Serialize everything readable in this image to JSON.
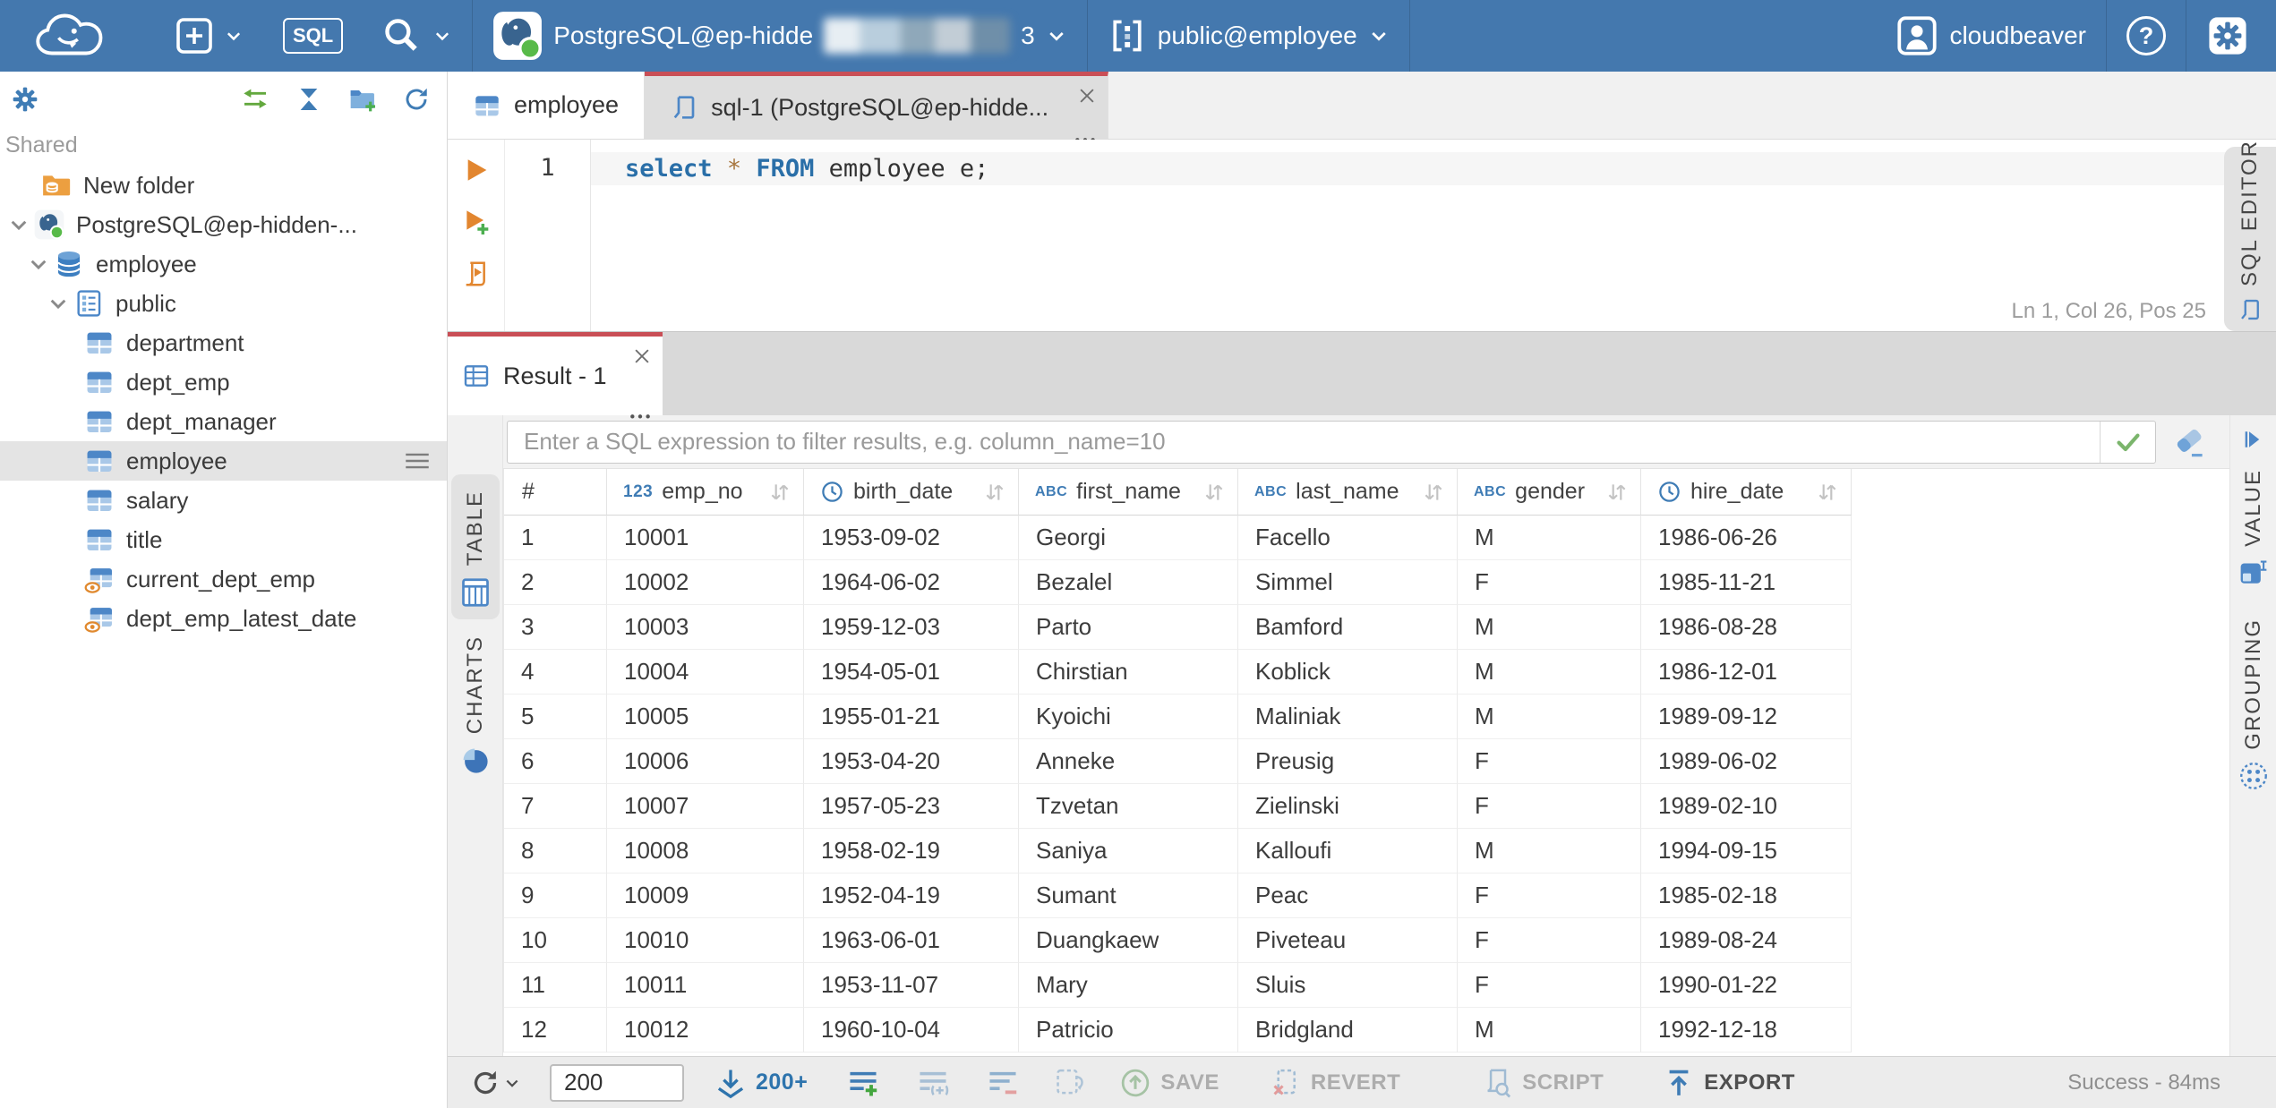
{
  "topbar": {
    "sql_badge": "SQL",
    "connection": {
      "name": "PostgreSQL@ep-hidde",
      "masked_suffix": "3"
    },
    "schema": "public@employee",
    "user": "cloudbeaver",
    "help_glyph": "?"
  },
  "sidebar": {
    "section_label": "Shared",
    "tree": [
      {
        "label": "New folder",
        "icon": "folderdb",
        "pad": 44,
        "chevron": false
      },
      {
        "label": "PostgreSQL@ep-hidden-...",
        "icon": "pg",
        "pad": 6,
        "chevron": true
      },
      {
        "label": "employee",
        "icon": "db",
        "pad": 28,
        "chevron": true
      },
      {
        "label": "public",
        "icon": "schema",
        "pad": 50,
        "chevron": true
      },
      {
        "label": "department",
        "icon": "table",
        "pad": 92,
        "chevron": false
      },
      {
        "label": "dept_emp",
        "icon": "table",
        "pad": 92,
        "chevron": false
      },
      {
        "label": "dept_manager",
        "icon": "table",
        "pad": 92,
        "chevron": false
      },
      {
        "label": "employee",
        "icon": "table",
        "pad": 92,
        "chevron": false,
        "selected": true,
        "menu": true
      },
      {
        "label": "salary",
        "icon": "table",
        "pad": 92,
        "chevron": false
      },
      {
        "label": "title",
        "icon": "table",
        "pad": 92,
        "chevron": false
      },
      {
        "label": "current_dept_emp",
        "icon": "view",
        "pad": 92,
        "chevron": false
      },
      {
        "label": "dept_emp_latest_date",
        "icon": "view",
        "pad": 92,
        "chevron": false
      }
    ]
  },
  "editor": {
    "tabs": [
      {
        "label": "employee"
      },
      {
        "label": "sql-1 (PostgreSQL@ep-hidde..."
      }
    ],
    "line_number": "1",
    "code": [
      {
        "t": "select",
        "c": "kw"
      },
      {
        "t": " ",
        "c": "pl"
      },
      {
        "t": "*",
        "c": "op"
      },
      {
        "t": " ",
        "c": "pl"
      },
      {
        "t": "FROM",
        "c": "kw"
      },
      {
        "t": " employee e;",
        "c": "pl"
      }
    ],
    "status": "Ln 1, Col 26, Pos 25",
    "right_tab_label": "SQL EDITOR"
  },
  "results": {
    "tab_label": "Result - 1",
    "filter_placeholder": "Enter a SQL expression to filter results, e.g. column_name=10",
    "left_tabs": [
      {
        "label": "TABLE"
      },
      {
        "label": "CHARTS"
      }
    ],
    "right_tabs": [
      {
        "label": "VALUE"
      },
      {
        "label": "GROUPING"
      }
    ]
  },
  "result_table": {
    "type_icons": {
      "number": "123",
      "string": "ABC"
    },
    "columns": [
      {
        "name": "#",
        "type": "rownum"
      },
      {
        "name": "emp_no",
        "type": "number"
      },
      {
        "name": "birth_date",
        "type": "date"
      },
      {
        "name": "first_name",
        "type": "string"
      },
      {
        "name": "last_name",
        "type": "string"
      },
      {
        "name": "gender",
        "type": "string"
      },
      {
        "name": "hire_date",
        "type": "date"
      }
    ],
    "rows": [
      [
        "1",
        "10001",
        "1953-09-02",
        "Georgi",
        "Facello",
        "M",
        "1986-06-26"
      ],
      [
        "2",
        "10002",
        "1964-06-02",
        "Bezalel",
        "Simmel",
        "F",
        "1985-11-21"
      ],
      [
        "3",
        "10003",
        "1959-12-03",
        "Parto",
        "Bamford",
        "M",
        "1986-08-28"
      ],
      [
        "4",
        "10004",
        "1954-05-01",
        "Chirstian",
        "Koblick",
        "M",
        "1986-12-01"
      ],
      [
        "5",
        "10005",
        "1955-01-21",
        "Kyoichi",
        "Maliniak",
        "M",
        "1989-09-12"
      ],
      [
        "6",
        "10006",
        "1953-04-20",
        "Anneke",
        "Preusig",
        "F",
        "1989-06-02"
      ],
      [
        "7",
        "10007",
        "1957-05-23",
        "Tzvetan",
        "Zielinski",
        "F",
        "1989-02-10"
      ],
      [
        "8",
        "10008",
        "1958-02-19",
        "Saniya",
        "Kalloufi",
        "M",
        "1994-09-15"
      ],
      [
        "9",
        "10009",
        "1952-04-19",
        "Sumant",
        "Peac",
        "F",
        "1985-02-18"
      ],
      [
        "10",
        "10010",
        "1963-06-01",
        "Duangkaew",
        "Piveteau",
        "F",
        "1989-08-24"
      ],
      [
        "11",
        "10011",
        "1953-11-07",
        "Mary",
        "Sluis",
        "F",
        "1990-01-22"
      ],
      [
        "12",
        "10012",
        "1960-10-04",
        "Patricio",
        "Bridgland",
        "M",
        "1992-12-18"
      ]
    ]
  },
  "toolbar": {
    "row_limit": "200",
    "fetch_more_label": "200+",
    "save_label": "SAVE",
    "revert_label": "REVERT",
    "script_label": "SCRIPT",
    "export_label": "EXPORT",
    "status": "Success - 84ms"
  },
  "colors": {
    "topbar_blue": "#4478ae",
    "accent_red": "#c94f56",
    "icon_blue": "#3f7cb5",
    "exec_orange": "#e2862f",
    "success_gray": "#8f8f8f"
  }
}
